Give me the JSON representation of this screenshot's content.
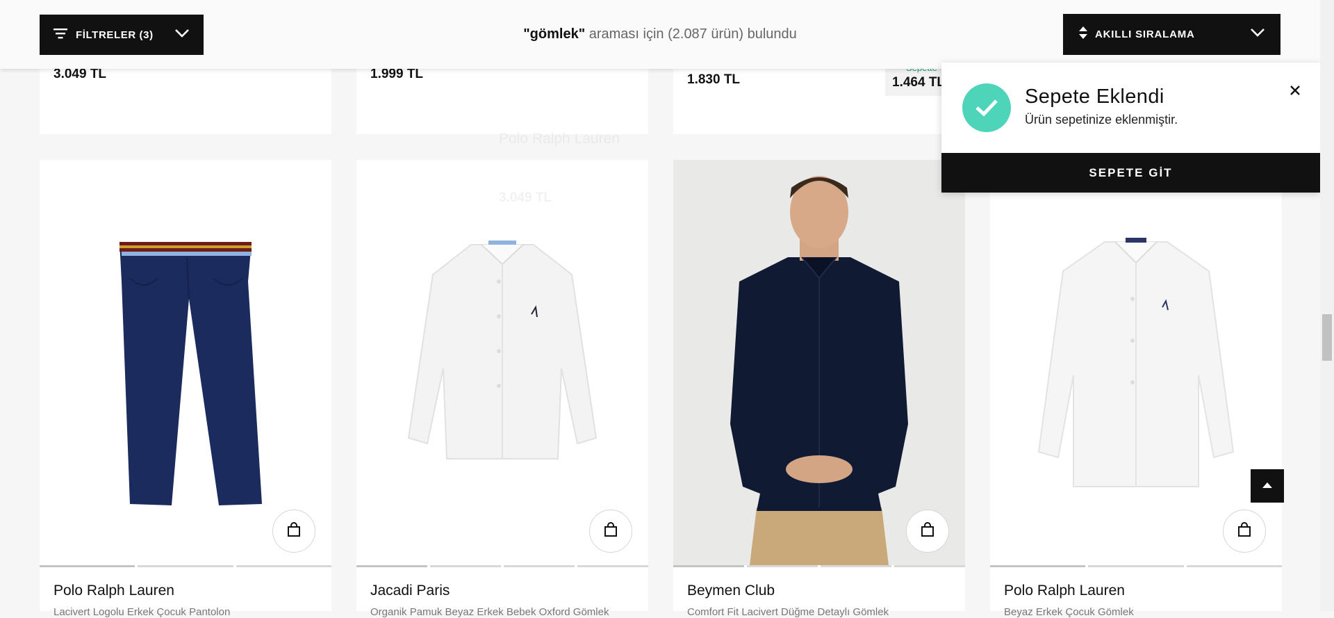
{
  "topbar": {
    "filters_label": "FİLTRELER (3)",
    "search_query": "\"gömlek\"",
    "result_text": " araması için (2.087 ürün) bulundu",
    "sort_label": "AKILLI SIRALAMA"
  },
  "prev_row": {
    "prices": [
      "3.049 TL",
      "1.999 TL",
      "1.830 TL"
    ],
    "discount_label": "Sepette",
    "discount_price": "1.464 TL"
  },
  "products": [
    {
      "brand": "Polo Ralph Lauren",
      "desc": "Lacivert Logolu Erkek Çocuk Pantolon"
    },
    {
      "brand": "Jacadi Paris",
      "desc": "Organik Pamuk Beyaz Erkek Bebek Oxford Gömlek"
    },
    {
      "brand": "Beymen Club",
      "desc": "Comfort Fit Lacivert Düğme Detaylı Gömlek"
    },
    {
      "brand": "Polo Ralph Lauren",
      "desc": "Beyaz Erkek Çocuk Gömlek"
    }
  ],
  "ghost": {
    "brand": "Polo Ralph Lauren",
    "price": "3.049 TL"
  },
  "popup": {
    "title": "Sepete Eklendi",
    "subtitle": "Ürün sepetinize eklenmiştir.",
    "button": "SEPETE GİT"
  },
  "icons": {
    "filter": "filter-lines-icon",
    "sort": "sort-arrows-icon",
    "bag": "shopping-bag-icon",
    "close": "close-icon",
    "check": "check-icon",
    "scroll_top": "arrow-up-icon"
  },
  "colors": {
    "accent_check": "#4ed5b9",
    "button_dark": "#111111",
    "discount_text": "#2e9d6a"
  }
}
